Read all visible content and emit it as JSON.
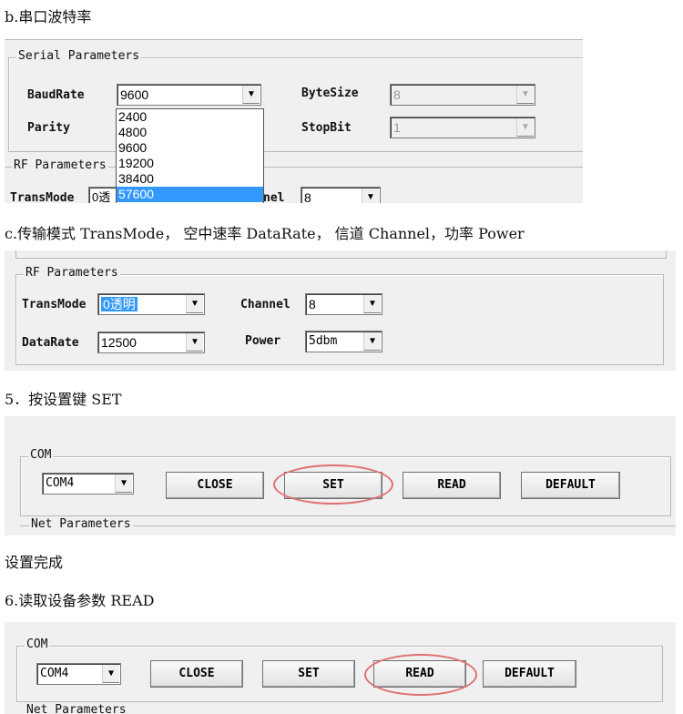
{
  "sections": {
    "b_title": "b.串口波特率",
    "c_title": "c.传输模式 TransMode， 空中速率 DataRate， 信道 Channel，功率 Power",
    "step5_title": "5．按设置键 SET",
    "set_done": "设置完成",
    "step6_title": "6.读取设备参数 READ"
  },
  "serial": {
    "legend": "Serial Parameters",
    "baudrate_label": "BaudRate",
    "baudrate_value": "9600",
    "bytesize_label": "ByteSize",
    "bytesize_value": "8",
    "parity_label": "Parity",
    "stopbit_label": "StopBit",
    "stopbit_value": "1",
    "baud_options": [
      "2400",
      "4800",
      "9600",
      "19200",
      "38400",
      "57600"
    ],
    "highlighted_option": "57600",
    "rf_legend": "RF Parameters",
    "transmode_label": "TransMode",
    "transmode_partial": "0透",
    "channel_partial": "nel",
    "channel_value": "8"
  },
  "rf": {
    "legend": "RF Parameters",
    "transmode_label": "TransMode",
    "transmode_value": "0透明",
    "channel_label": "Channel",
    "channel_value": "8",
    "datarate_label": "DataRate",
    "datarate_value": "12500",
    "power_label": "Power",
    "power_value": "5dbm"
  },
  "com": {
    "legend": "COM",
    "port": "COM4",
    "close": "CLOSE",
    "set": "SET",
    "read": "READ",
    "default": "DEFAULT",
    "net_legend": "Net Parameters"
  },
  "highlight_color": "#e07070",
  "selection_color": "#3399ff"
}
